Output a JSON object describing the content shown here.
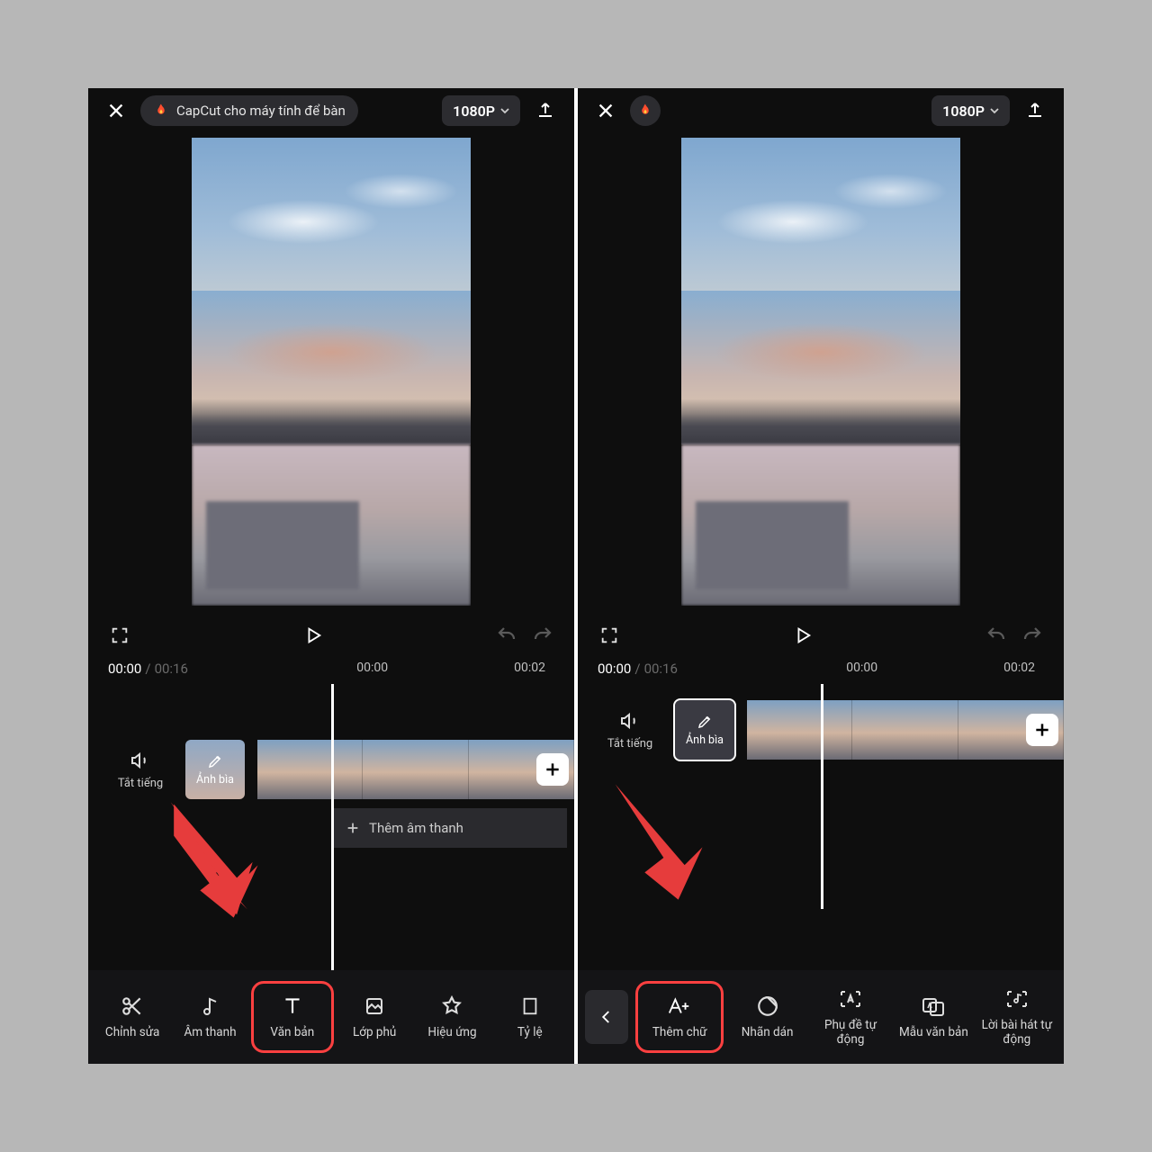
{
  "left": {
    "banner_text": "CapCut cho máy tính để bàn",
    "resolution": "1080P",
    "time_current": "00:00",
    "time_total": "00:16",
    "ticks": [
      "00:00",
      "00:02"
    ],
    "mute_label": "Tắt tiếng",
    "cover_label": "Ảnh bìa",
    "add_audio_label": "Thêm âm thanh",
    "tools": [
      {
        "label": "Chỉnh sửa"
      },
      {
        "label": "Âm thanh"
      },
      {
        "label": "Văn bản"
      },
      {
        "label": "Lớp phủ"
      },
      {
        "label": "Hiệu ứng"
      },
      {
        "label": "Tỷ lệ"
      }
    ]
  },
  "right": {
    "resolution": "1080P",
    "time_current": "00:00",
    "time_total": "00:16",
    "ticks": [
      "00:00",
      "00:02"
    ],
    "mute_label": "Tắt tiếng",
    "cover_label": "Ảnh bìa",
    "tools": [
      {
        "label": "Thêm chữ"
      },
      {
        "label": "Nhãn dán"
      },
      {
        "label": "Phụ đề tự động"
      },
      {
        "label": "Mẫu văn bản"
      },
      {
        "label": "Lời bài hát tự động"
      }
    ]
  }
}
